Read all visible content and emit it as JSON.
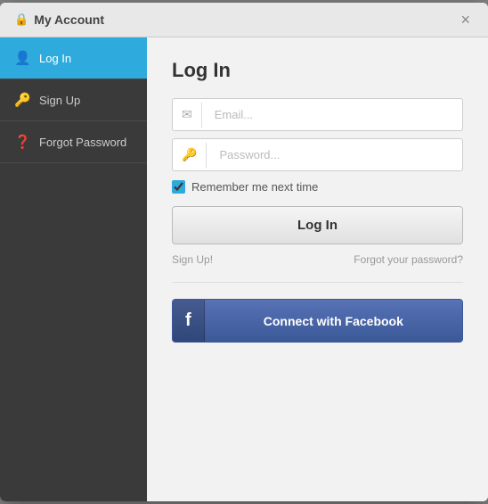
{
  "header": {
    "title": "My Account",
    "close_label": "×"
  },
  "sidebar": {
    "items": [
      {
        "id": "login",
        "label": "Log In",
        "icon": "👤",
        "active": true
      },
      {
        "id": "signup",
        "label": "Sign Up",
        "icon": "🔑",
        "active": false
      },
      {
        "id": "forgot",
        "label": "Forgot Password",
        "icon": "❓",
        "active": false
      }
    ]
  },
  "main": {
    "title": "Log In",
    "email_placeholder": "Email...",
    "password_placeholder": "Password...",
    "remember_label": "Remember me next time",
    "login_button": "Log In",
    "signup_link": "Sign Up!",
    "forgot_link": "Forgot your password?",
    "facebook_button": "Connect with Facebook"
  }
}
